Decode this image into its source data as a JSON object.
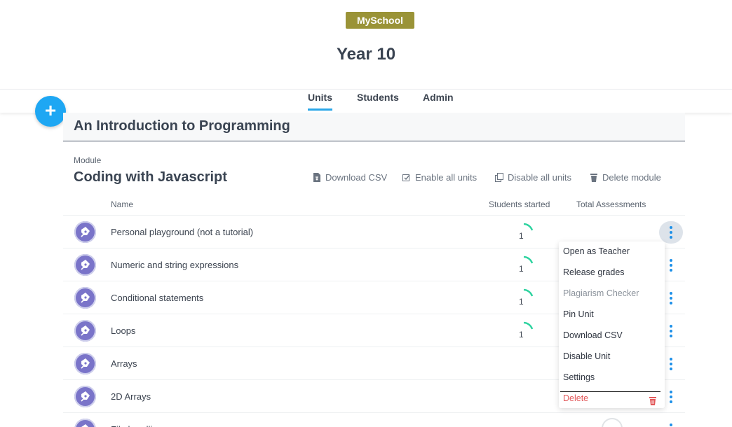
{
  "header": {
    "school": "MySchool",
    "title": "Year 10"
  },
  "tabs": [
    {
      "label": "Units"
    },
    {
      "label": "Students"
    },
    {
      "label": "Admin"
    }
  ],
  "course": {
    "title": "An Introduction to Programming"
  },
  "module": {
    "label": "Module",
    "title": "Coding with Javascript",
    "actions": {
      "download_csv": "Download CSV",
      "enable_all": "Enable all units",
      "disable_all": "Disable all units",
      "delete_module": "Delete module"
    }
  },
  "columns": {
    "name": "Name",
    "students_started": "Students started",
    "total_assessments": "Total Assessments"
  },
  "units": [
    {
      "name": "Personal playground (not a tutorial)",
      "started": "1"
    },
    {
      "name": "Numeric and string expressions",
      "started": "1"
    },
    {
      "name": "Conditional statements",
      "started": "1"
    },
    {
      "name": "Loops",
      "started": "1"
    },
    {
      "name": "Arrays",
      "started": ""
    },
    {
      "name": "2D Arrays",
      "started": ""
    },
    {
      "name": "File handling",
      "started": ""
    }
  ],
  "menu": {
    "open_as_teacher": "Open as Teacher",
    "release_grades": "Release grades",
    "plagiarism_checker": "Plagiarism Checker",
    "pin_unit": "Pin Unit",
    "download_csv": "Download CSV",
    "disable_unit": "Disable Unit",
    "settings": "Settings",
    "delete": "Delete"
  },
  "icons": {
    "add": "plus-icon",
    "unit": "pen-nib-icon",
    "more": "kebab-icon",
    "trash": "trash-icon"
  },
  "colors": {
    "accent": "#1ea7f3",
    "badge": "#9a9337",
    "progress": "#2fd3a0",
    "danger": "#e2585a"
  }
}
